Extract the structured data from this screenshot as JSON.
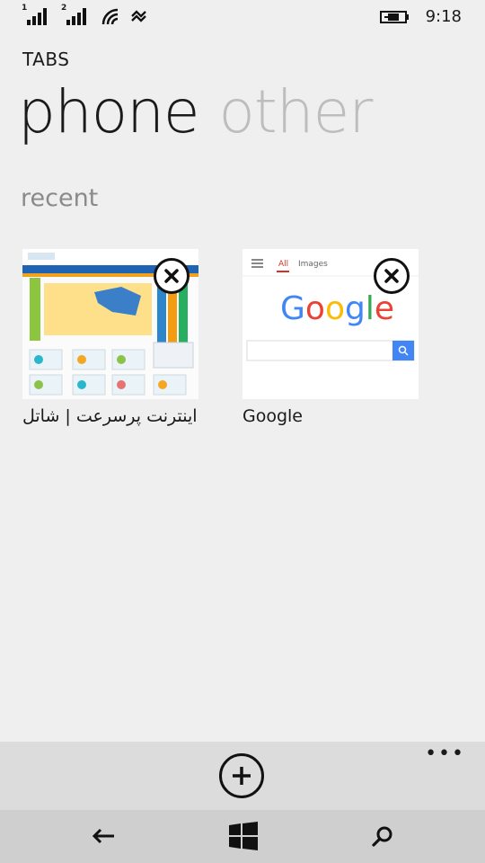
{
  "status_bar": {
    "sim1": "1",
    "sim2": "2",
    "time": "9:18",
    "icons": [
      "signal-sim1-icon",
      "signal-sim2-icon",
      "wifi-icon",
      "data-sharing-icon",
      "battery-charging-icon"
    ]
  },
  "header": {
    "title": "TABS"
  },
  "pivot": {
    "active": "phone",
    "inactive": "other"
  },
  "section": {
    "title": "recent"
  },
  "tabs": [
    {
      "title": "اینترنت پرسرعت | شاتل"
    },
    {
      "title": "Google",
      "preview": {
        "tab_all": "All",
        "tab_images": "Images",
        "logo": "Google"
      }
    }
  ],
  "appbar": {
    "more": "•••",
    "icons": [
      "add-icon"
    ]
  },
  "navbar": {
    "icons": [
      "back-arrow-icon",
      "windows-start-icon",
      "search-icon"
    ]
  },
  "colors": {
    "background": "#efefef",
    "accent_red": "#d93025",
    "google_blue": "#4285f4"
  }
}
